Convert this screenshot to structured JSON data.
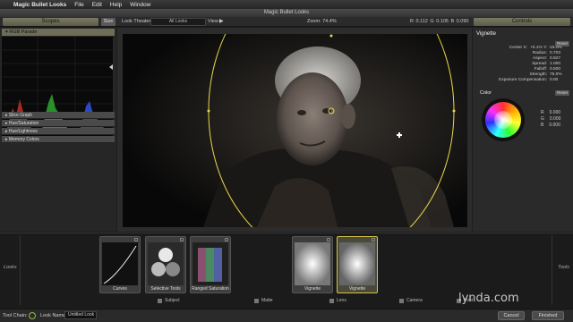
{
  "menubar": {
    "apple": "",
    "items": [
      "Magic Bullet Looks",
      "File",
      "Edit",
      "Help",
      "Window"
    ]
  },
  "window": {
    "title": "Magic Bullet Looks"
  },
  "toolbar": {
    "scopes": "Scopes",
    "size": "Size",
    "look_theater": "Look Theater",
    "look_select": "All Looks",
    "view": "View",
    "zoom": "Zoom:  74.4%",
    "rgb": "R 0.112  G 0.105  B 0.090",
    "controls": "Controls"
  },
  "left": {
    "parade_title": "RGB Parade",
    "sections": [
      "Slice Graph",
      "Hue/Saturation",
      "Hue/Lightness",
      "Memory Colors"
    ]
  },
  "controls": {
    "title": "Vignette",
    "reset": "Reset",
    "params": [
      {
        "label": "Center X:",
        "value": "+0.1%  Y:  -15.0%"
      },
      {
        "label": "Radius:",
        "value": "0.703"
      },
      {
        "label": "Aspect:",
        "value": "0.827"
      },
      {
        "label": "Spread:",
        "value": "1.000"
      },
      {
        "label": "Falloff:",
        "value": "0.500"
      },
      {
        "label": "Strength:",
        "value": "75.0%"
      },
      {
        "label": "Exposure Compensation:",
        "value": "0.00"
      }
    ],
    "color_title": "Color",
    "color_reset": "Reset",
    "rgb": [
      {
        "ch": "R",
        "val": "0.000"
      },
      {
        "ch": "G",
        "val": "0.000"
      },
      {
        "ch": "B",
        "val": "0.000"
      }
    ]
  },
  "chain": {
    "left_label": "Looks",
    "right_label": "Tools",
    "tools": [
      "Curves",
      "Selective Tools",
      "Ranged Saturation",
      "Vignette",
      "Vignette"
    ],
    "categories": [
      "Subject",
      "Matte",
      "Lens",
      "Camera",
      "Post"
    ]
  },
  "status": {
    "tool_chain": "Tool Chain:",
    "look_name_label": "Look Name:",
    "look_name": "Untitled Look",
    "cancel": "Cancel",
    "finished": "Finished"
  },
  "watermark": "lynda.com"
}
